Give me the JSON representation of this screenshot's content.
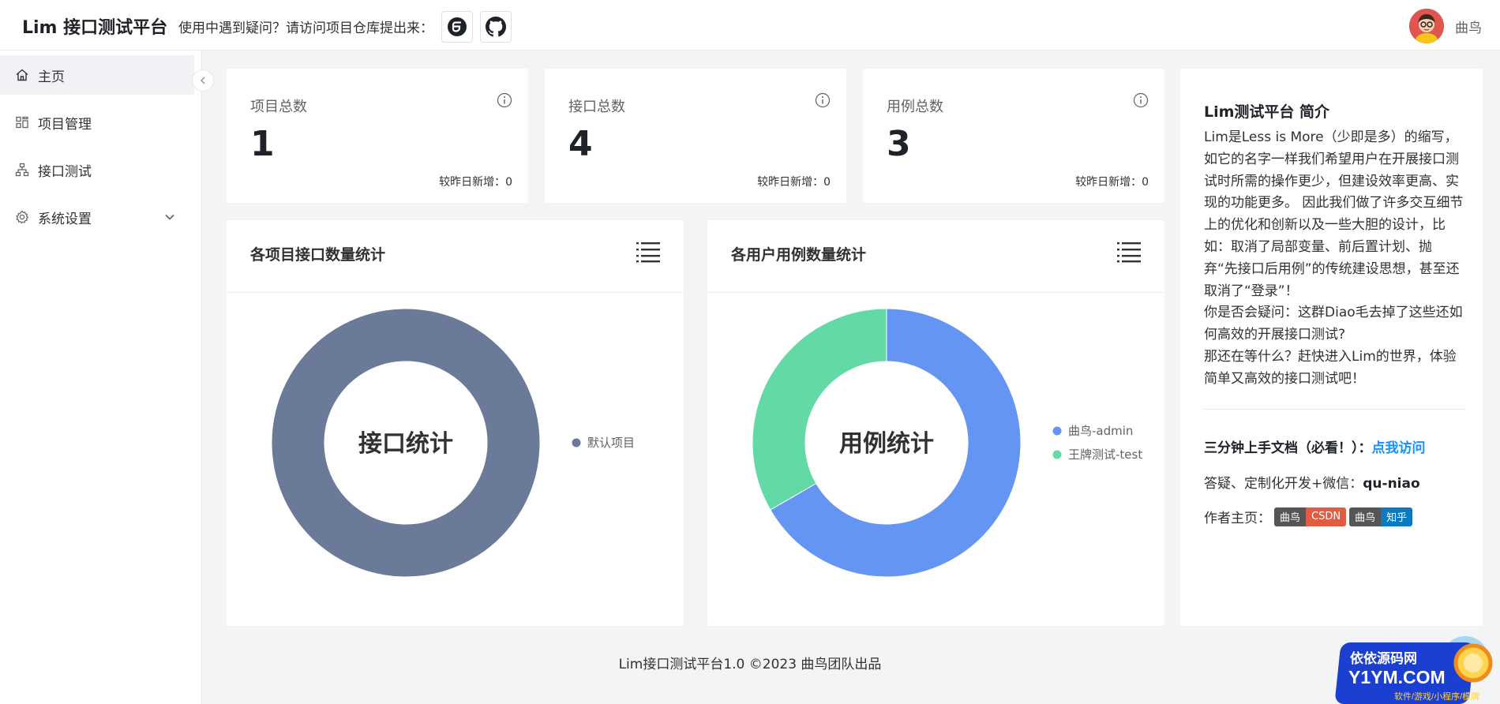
{
  "header": {
    "brand": "Lim 接口测试平台",
    "help_text": "使用中遇到疑问？请访问项目仓库提出来：",
    "user_name": "曲鸟"
  },
  "sidebar": {
    "items": [
      {
        "label": "主页",
        "icon": "home-icon",
        "active": true
      },
      {
        "label": "项目管理",
        "icon": "grid-icon"
      },
      {
        "label": "接口测试",
        "icon": "sitemap-icon"
      },
      {
        "label": "系统设置",
        "icon": "gear-icon",
        "expandable": true
      }
    ]
  },
  "stats": [
    {
      "title": "项目总数",
      "value": "1",
      "new_label": "较昨日新增：0"
    },
    {
      "title": "接口总数",
      "value": "4",
      "new_label": "较昨日新增：0"
    },
    {
      "title": "用例总数",
      "value": "3",
      "new_label": "较昨日新增：0"
    }
  ],
  "charts": {
    "left": {
      "title": "各项目接口数量统计",
      "center_label": "接口统计"
    },
    "right": {
      "title": "各用户用例数量统计",
      "center_label": "用例统计"
    }
  },
  "chart_data": [
    {
      "type": "pie",
      "title": "各项目接口数量统计",
      "center_label": "接口统计",
      "donut": true,
      "legend_position": "right",
      "series": [
        {
          "name": "默认项目",
          "value": 4,
          "color": "#6b7a99"
        }
      ]
    },
    {
      "type": "pie",
      "title": "各用户用例数量统计",
      "center_label": "用例统计",
      "donut": true,
      "legend_position": "right",
      "series": [
        {
          "name": "曲鸟-admin",
          "value": 2,
          "color": "#6495f2"
        },
        {
          "name": "王牌测试-test",
          "value": 1,
          "color": "#63d9a6"
        }
      ]
    }
  ],
  "intro": {
    "title": "Lim测试平台 简介",
    "paragraphs": [
      "Lim是Less is More（少即是多）的缩写，如它的名字一样我们希望用户在开展接口测试时所需的操作更少，但建设效率更高、实现的功能更多。 因此我们做了许多交互细节上的优化和创新以及一些大胆的设计，比如：取消了局部变量、前后置计划、抛弃“先接口后用例”的传统建设思想，甚至还取消了“登录”！",
      "你是否会疑问：这群Diao毛去掉了这些还如何高效的开展接口测试?",
      "那还在等什么？赶快进入Lim的世界，体验简单又高效的接口测试吧！"
    ],
    "doc_label": "三分钟上手文档（必看！）：",
    "doc_link": "点我访问",
    "contact_label": "答疑、定制化开发+微信：",
    "contact_wechat": "qu-niao",
    "author_label": "作者主页：",
    "badges": [
      {
        "left": "曲鸟",
        "right": "CSDN",
        "color": "#e05d44"
      },
      {
        "left": "曲鸟",
        "right": "知乎",
        "color": "#0d7ac0"
      }
    ]
  },
  "footer": "Lim接口测试平台1.0 ©2023 曲鸟团队出品",
  "watermark": {
    "line1": "依依源码网",
    "line2": "Y1YM.COM",
    "line3": "软件/游戏/小程序/模牌"
  }
}
